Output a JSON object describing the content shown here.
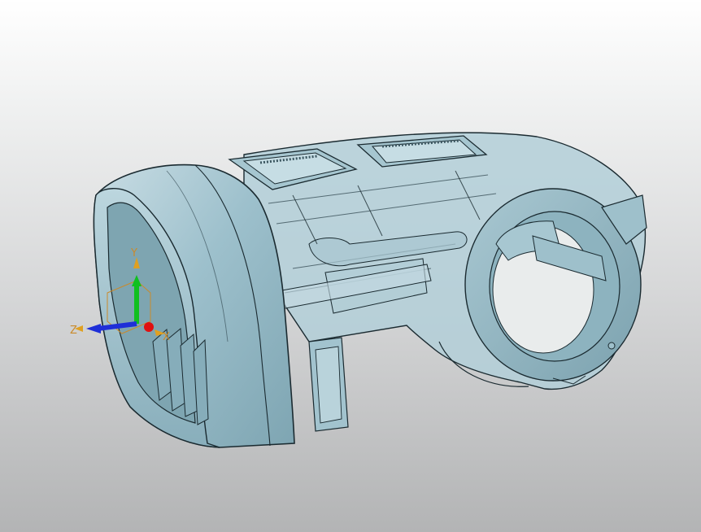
{
  "viewport": {
    "background_top": "#ffffff",
    "background_bottom": "#b3b4b5"
  },
  "model": {
    "body_color": "#9cc0cc",
    "translucent_color": "#b9d3dc",
    "edge_color": "#1a2a30",
    "shadow_color": "#6f939f"
  },
  "triad": {
    "x_label": "X",
    "y_label": "Y",
    "z_label": "Z",
    "x_color": "#e01010",
    "y_color": "#10c020",
    "z_color": "#1e2fd8",
    "arrow_tip_color": "#e0a020"
  }
}
